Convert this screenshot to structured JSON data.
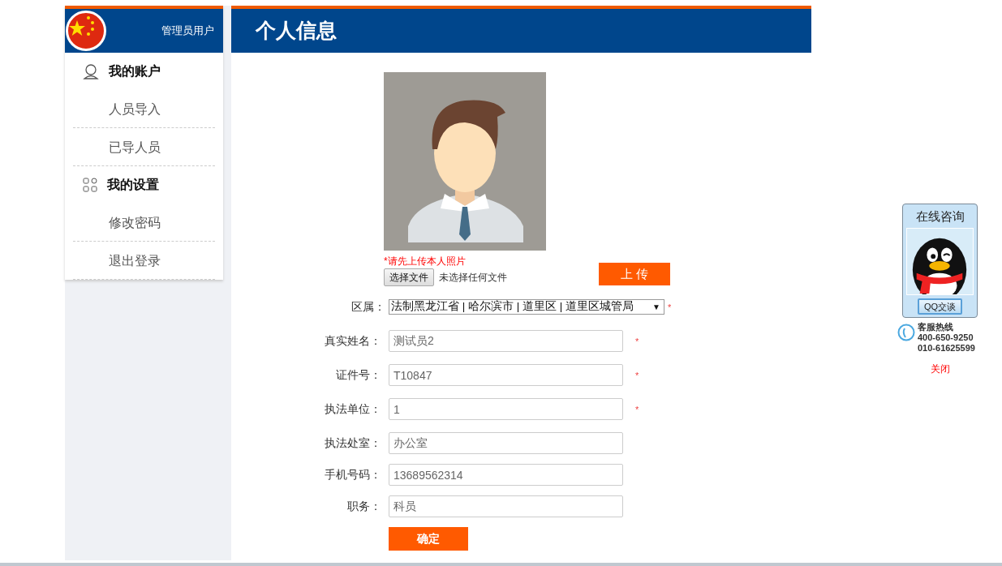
{
  "sidebar": {
    "user_label": "管理员用户",
    "sections": [
      {
        "kind": "account",
        "title": "我的账户",
        "items": [
          "人员导入",
          "已导人员"
        ]
      },
      {
        "kind": "settings",
        "title": "我的设置",
        "items": [
          "修改密码",
          "退出登录"
        ]
      }
    ]
  },
  "page": {
    "title": "个人信息"
  },
  "photo": {
    "hint": "*请先上传本人照片",
    "file_button": "选择文件",
    "file_status": "未选择任何文件",
    "upload_button": "上 传"
  },
  "region": {
    "label": "区属：",
    "value": "法制黑龙江省 | 哈尔滨市 | 道里区 | 道里区城管局",
    "arrow": "▼",
    "required_mark": "*"
  },
  "fields": [
    {
      "label": "真实姓名：",
      "value": "测试员2",
      "required_mark": "*"
    },
    {
      "label": "证件号：",
      "value": "T10847",
      "required_mark": "*"
    },
    {
      "label": "执法单位：",
      "value": "1",
      "required_mark": "*"
    },
    {
      "label": "执法处室：",
      "value": "办公室"
    },
    {
      "label": "手机号码：",
      "value": "13689562314"
    },
    {
      "label": "职务：",
      "value": "科员"
    }
  ],
  "submit_button": "确定",
  "chat_widget": {
    "title": "在线咨询",
    "chat_button": "QQ交谈",
    "hotline_label": "客服热线",
    "phones": [
      "400-650-9250",
      "010-61625599"
    ],
    "close_link": "关闭"
  }
}
